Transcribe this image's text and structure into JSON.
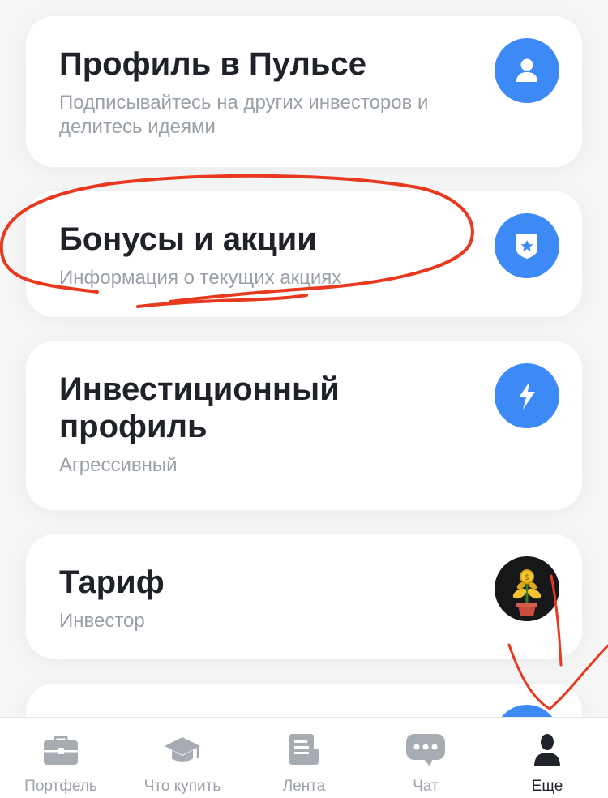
{
  "cards": [
    {
      "title": "Профиль в Пульсе",
      "subtitle": "Подписывайтесь на других инвесторов и делитесь идеями",
      "icon": "user-icon"
    },
    {
      "title": "Бонусы и акции",
      "subtitle": "Информация о текущих акциях",
      "icon": "shield-star-icon"
    },
    {
      "title": "Инвестиционный профиль",
      "subtitle": "Агрессивный",
      "icon": "lightning-icon"
    },
    {
      "title": "Тариф",
      "subtitle": "Инвестор",
      "icon": "money-plant-icon"
    },
    {
      "title": "",
      "subtitle": "",
      "icon": "partial-icon"
    }
  ],
  "tabbar": [
    {
      "label": "Портфель",
      "icon": "briefcase-icon",
      "active": false
    },
    {
      "label": "Что купить",
      "icon": "graduation-cap-icon",
      "active": false
    },
    {
      "label": "Лента",
      "icon": "document-icon",
      "active": false
    },
    {
      "label": "Чат",
      "icon": "chat-bubble-icon",
      "active": false
    },
    {
      "label": "Еще",
      "icon": "person-icon",
      "active": true
    }
  ],
  "colors": {
    "accent": "#3d8af7",
    "annotation": "#e8391f",
    "tab_inactive": "#9ea3aa",
    "tab_active": "#1f2329"
  }
}
